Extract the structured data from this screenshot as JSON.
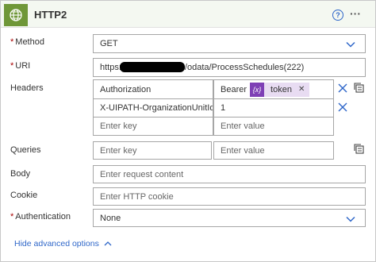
{
  "header": {
    "title": "HTTP2",
    "icon": "globe-icon",
    "help_glyph": "?",
    "more_glyph": "···"
  },
  "method": {
    "label": "Method",
    "value": "GET"
  },
  "uri": {
    "label": "URI",
    "prefix": "https:",
    "suffix": "/odata/ProcessSchedules(222)"
  },
  "headers": {
    "label": "Headers",
    "rows": [
      {
        "key": "Authorization",
        "value_prefix": "Bearer",
        "token_glyph": "{x}",
        "token_text": "token"
      },
      {
        "key": "X-UIPATH-OrganizationUnitId",
        "value": "1"
      }
    ],
    "key_placeholder": "Enter key",
    "value_placeholder": "Enter value"
  },
  "queries": {
    "label": "Queries",
    "key_placeholder": "Enter key",
    "value_placeholder": "Enter value"
  },
  "body": {
    "label": "Body",
    "placeholder": "Enter request content"
  },
  "cookie": {
    "label": "Cookie",
    "placeholder": "Enter HTTP cookie"
  },
  "authentication": {
    "label": "Authentication",
    "value": "None"
  },
  "advanced_link": "Hide advanced options",
  "required_marker": "*",
  "colors": {
    "accent": "#2f67c9",
    "connector": "#6f9738",
    "token": "#7e3fb5",
    "required": "#a80000"
  }
}
